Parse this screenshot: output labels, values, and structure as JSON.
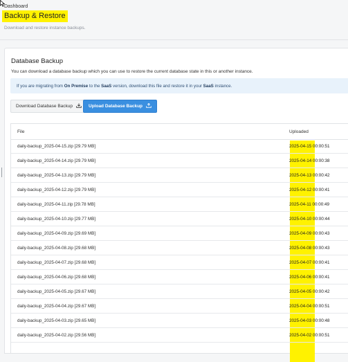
{
  "header": {
    "breadcrumb": "Dashboard",
    "title": "Backup & Restore",
    "subtitle": "Download and restore instance backups."
  },
  "card": {
    "title": "Database Backup",
    "description": "You can download a database backup which you can use to restore the current database state in this or another instance.",
    "info": {
      "t1": "If you are migrating from ",
      "b1": "On Premise",
      "t2": " to the ",
      "b2": "SaaS",
      "t3": " version, download this file and restore it in your ",
      "b3": "SaaS",
      "t4": " instance."
    },
    "download_button": "Download Database Backup",
    "upload_button": "Upload Database Backup"
  },
  "table": {
    "headers": {
      "file": "File",
      "uploaded": "Uploaded"
    },
    "rows": [
      {
        "file": "daily-backup_2025-04-15.zip [29.79 MB]",
        "uploaded": "2025-04-15 00:00:51"
      },
      {
        "file": "daily-backup_2025-04-14.zip [29.79 MB]",
        "uploaded": "2025-04-14 00:00:38"
      },
      {
        "file": "daily-backup_2025-04-13.zip [29.79 MB]",
        "uploaded": "2025-04-13 00:00:42"
      },
      {
        "file": "daily-backup_2025-04-12.zip [29.79 MB]",
        "uploaded": "2025-04-12 00:00:41"
      },
      {
        "file": "daily-backup_2025-04-11.zip [29.78 MB]",
        "uploaded": "2025-04-11 00:00:49"
      },
      {
        "file": "daily-backup_2025-04-10.zip [29.77 MB]",
        "uploaded": "2025-04-10 00:00:44"
      },
      {
        "file": "daily-backup_2025-04-09.zip [29.69 MB]",
        "uploaded": "2025-04-09 00:00:43"
      },
      {
        "file": "daily-backup_2025-04-08.zip [29.68 MB]",
        "uploaded": "2025-04-08 00:00:43"
      },
      {
        "file": "daily-backup_2025-04-07.zip [29.68 MB]",
        "uploaded": "2025-04-07 00:00:41"
      },
      {
        "file": "daily-backup_2025-04-06.zip [29.68 MB]",
        "uploaded": "2025-04-06 00:00:41"
      },
      {
        "file": "daily-backup_2025-04-05.zip [29.67 MB]",
        "uploaded": "2025-04-05 00:00:42"
      },
      {
        "file": "daily-backup_2025-04-04.zip [29.67 MB]",
        "uploaded": "2025-04-04 00:00:51"
      },
      {
        "file": "daily-backup_2025-04-03.zip [29.65 MB]",
        "uploaded": "2025-04-03 00:00:48"
      },
      {
        "file": "daily-backup_2025-04-02.zip [29.56 MB]",
        "uploaded": "2025-04-02 00:00:51"
      }
    ]
  },
  "colors": {
    "highlight": "#fff200",
    "primary": "#3a8fe0",
    "info_bg": "#e8f2fb"
  },
  "icons": {
    "download": "download-icon",
    "upload": "upload-icon",
    "cursor": "mouse-cursor-icon"
  }
}
